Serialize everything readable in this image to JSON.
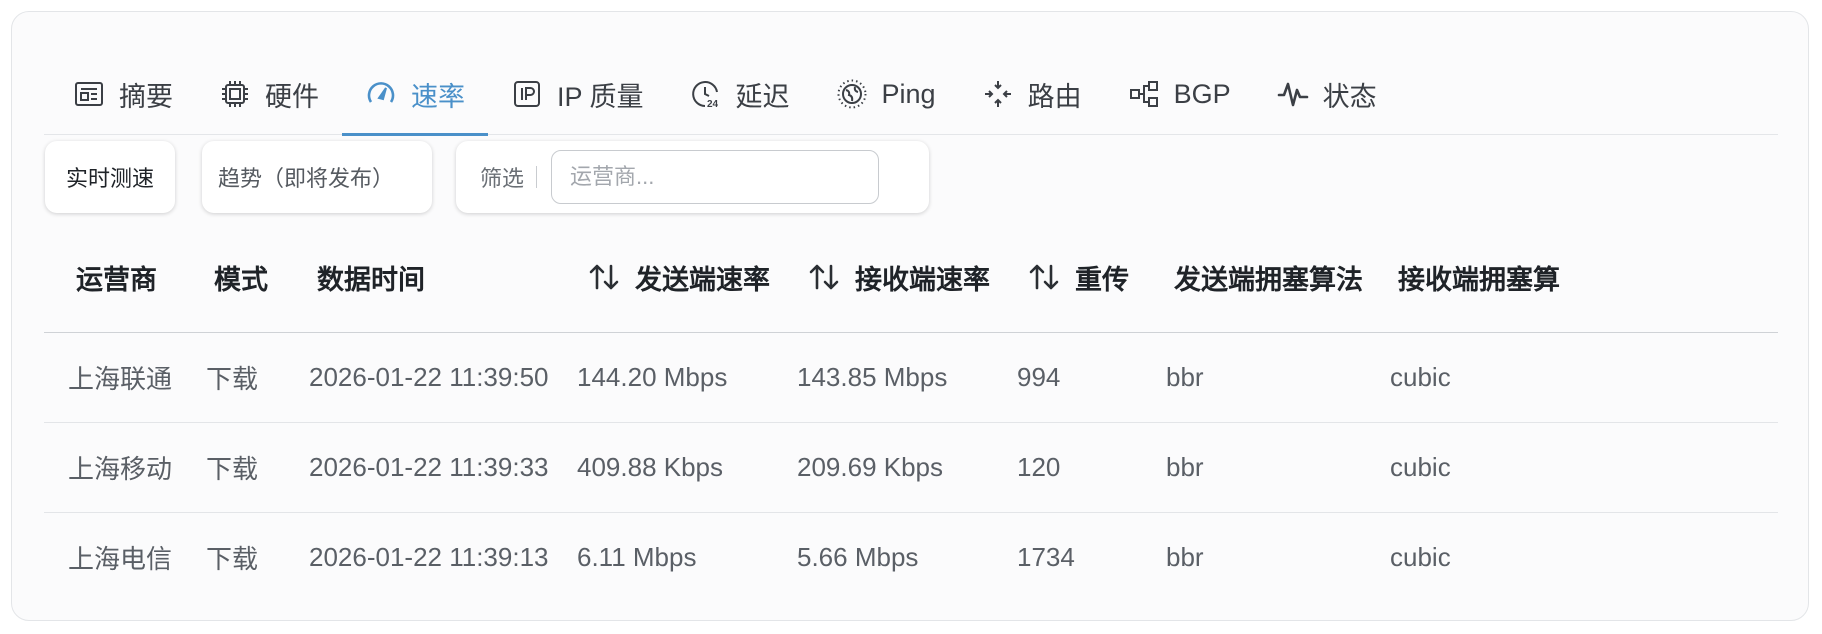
{
  "tabs": [
    {
      "label": "摘要",
      "icon": "summary-icon",
      "active": false
    },
    {
      "label": "硬件",
      "icon": "chip-icon",
      "active": false
    },
    {
      "label": "速率",
      "icon": "speedometer-icon",
      "active": true
    },
    {
      "label": "IP 质量",
      "icon": "ip-icon",
      "active": false
    },
    {
      "label": "延迟",
      "icon": "clock-24-icon",
      "active": false
    },
    {
      "label": "Ping",
      "icon": "globe-icon",
      "active": false
    },
    {
      "label": "路由",
      "icon": "route-icon",
      "active": false
    },
    {
      "label": "BGP",
      "icon": "network-nodes-icon",
      "active": false
    },
    {
      "label": "状态",
      "icon": "activity-icon",
      "active": false
    }
  ],
  "controls": {
    "realtime_label": "实时测速",
    "trend_label": "趋势（即将发布）",
    "filter_label": "筛选",
    "filter_placeholder": "运营商..."
  },
  "table": {
    "columns": [
      "运营商",
      "模式",
      "数据时间",
      "发送端速率",
      "接收端速率",
      "重传",
      "发送端拥塞算法",
      "接收端拥塞算"
    ],
    "sortable": [
      false,
      false,
      false,
      true,
      true,
      true,
      false,
      false
    ],
    "rows": [
      [
        "上海联通",
        "下载",
        "2026-01-22 11:39:50",
        "144.20 Mbps",
        "143.85 Mbps",
        "994",
        "bbr",
        "cubic"
      ],
      [
        "上海移动",
        "下载",
        "2026-01-22 11:39:33",
        "409.88 Kbps",
        "209.69 Kbps",
        "120",
        "bbr",
        "cubic"
      ],
      [
        "上海电信",
        "下载",
        "2026-01-22 11:39:13",
        "6.11 Mbps",
        "5.66 Mbps",
        "1734",
        "bbr",
        "cubic"
      ]
    ]
  },
  "colors": {
    "accent": "#4a90c9",
    "text": "#1f2328",
    "muted_text": "#5a5f66"
  }
}
